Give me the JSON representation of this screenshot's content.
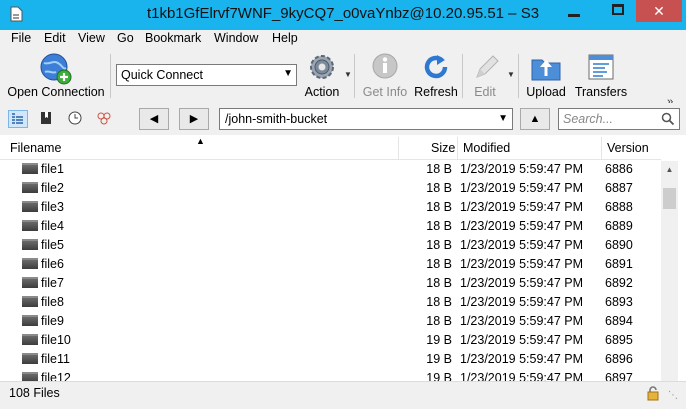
{
  "window": {
    "title": "t1kb1GfElrvf7WNF_9kyCQ7_o0vaYnbz@10.20.95.51 – S3"
  },
  "menu": [
    "File",
    "Edit",
    "View",
    "Go",
    "Bookmark",
    "Window",
    "Help"
  ],
  "toolbar": {
    "open_connection": "Open Connection",
    "quick_connect": "Quick Connect",
    "action": "Action",
    "get_info": "Get Info",
    "refresh": "Refresh",
    "edit": "Edit",
    "upload": "Upload",
    "transfers": "Transfers"
  },
  "nav": {
    "path": "/john-smith-bucket",
    "search_placeholder": "Search..."
  },
  "table": {
    "headers": {
      "filename": "Filename",
      "size": "Size",
      "modified": "Modified",
      "version": "Version"
    },
    "rows": [
      {
        "name": "file1",
        "size": "18 B",
        "modified": "1/23/2019 5:59:47 PM",
        "version": "6886"
      },
      {
        "name": "file2",
        "size": "18 B",
        "modified": "1/23/2019 5:59:47 PM",
        "version": "6887"
      },
      {
        "name": "file3",
        "size": "18 B",
        "modified": "1/23/2019 5:59:47 PM",
        "version": "6888"
      },
      {
        "name": "file4",
        "size": "18 B",
        "modified": "1/23/2019 5:59:47 PM",
        "version": "6889"
      },
      {
        "name": "file5",
        "size": "18 B",
        "modified": "1/23/2019 5:59:47 PM",
        "version": "6890"
      },
      {
        "name": "file6",
        "size": "18 B",
        "modified": "1/23/2019 5:59:47 PM",
        "version": "6891"
      },
      {
        "name": "file7",
        "size": "18 B",
        "modified": "1/23/2019 5:59:47 PM",
        "version": "6892"
      },
      {
        "name": "file8",
        "size": "18 B",
        "modified": "1/23/2019 5:59:47 PM",
        "version": "6893"
      },
      {
        "name": "file9",
        "size": "18 B",
        "modified": "1/23/2019 5:59:47 PM",
        "version": "6894"
      },
      {
        "name": "file10",
        "size": "19 B",
        "modified": "1/23/2019 5:59:47 PM",
        "version": "6895"
      },
      {
        "name": "file11",
        "size": "19 B",
        "modified": "1/23/2019 5:59:47 PM",
        "version": "6896"
      },
      {
        "name": "file12",
        "size": "19 B",
        "modified": "1/23/2019 5:59:47 PM",
        "version": "6897"
      }
    ]
  },
  "status": {
    "text": "108 Files"
  }
}
